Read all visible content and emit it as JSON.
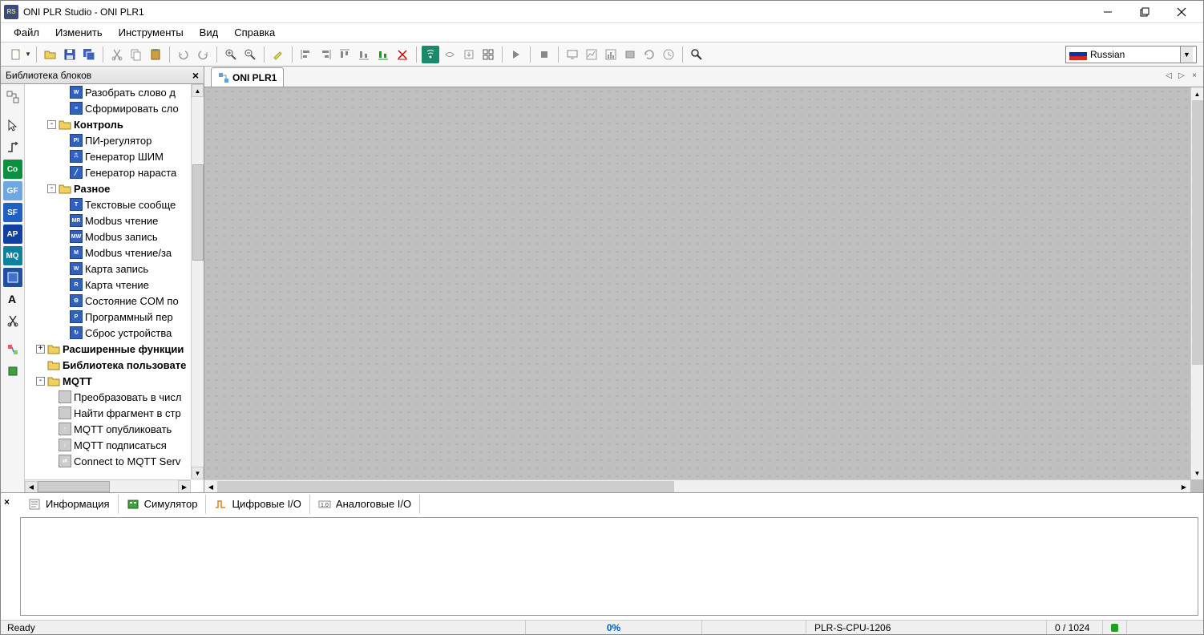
{
  "title": "ONI PLR Studio - ONI PLR1",
  "app_icon_text": "RS",
  "menu": {
    "file": "Файл",
    "edit": "Изменить",
    "tools": "Инструменты",
    "view": "Вид",
    "help": "Справка"
  },
  "language": {
    "selected": "Russian"
  },
  "lib": {
    "title": "Библиотека блоков",
    "items": [
      {
        "indent": 4,
        "icon": "blue-w",
        "label": "Разобрать слово д"
      },
      {
        "indent": 4,
        "icon": "blue-s",
        "label": "Сформировать сло"
      },
      {
        "indent": 2,
        "folder": true,
        "expand": "-",
        "label": "Контроль",
        "bold": true
      },
      {
        "indent": 4,
        "icon": "blue-pi",
        "label": "ПИ-регулятор"
      },
      {
        "indent": 4,
        "icon": "blue-pwm",
        "label": "Генератор ШИМ"
      },
      {
        "indent": 4,
        "icon": "blue-ramp",
        "label": "Генератор нараста"
      },
      {
        "indent": 2,
        "folder": true,
        "expand": "-",
        "label": "Разное",
        "bold": true
      },
      {
        "indent": 4,
        "icon": "blue-t",
        "label": "Текстовые сообще"
      },
      {
        "indent": 4,
        "icon": "blue-mr",
        "label": "Modbus чтение"
      },
      {
        "indent": 4,
        "icon": "blue-mw",
        "label": "Modbus запись"
      },
      {
        "indent": 4,
        "icon": "blue-mrw",
        "label": "Modbus чтение/за"
      },
      {
        "indent": 4,
        "icon": "blue-cw",
        "label": "Карта запись"
      },
      {
        "indent": 4,
        "icon": "blue-cr",
        "label": "Карта чтение"
      },
      {
        "indent": 4,
        "icon": "blue-com",
        "label": "Состояние COM по"
      },
      {
        "indent": 4,
        "icon": "blue-prog",
        "label": "Программный пер"
      },
      {
        "indent": 4,
        "icon": "blue-rst",
        "label": "Сброс устройства"
      },
      {
        "indent": 1,
        "folder": true,
        "expand": "+",
        "label": "Расширенные функции",
        "bold": true
      },
      {
        "indent": 1,
        "folder": true,
        "expand": "",
        "label": "Библиотека пользовате",
        "bold": true
      },
      {
        "indent": 1,
        "folder": true,
        "expand": "-",
        "label": "MQTT",
        "bold": true
      },
      {
        "indent": 3,
        "icon": "grey",
        "label": "Преобразовать в числ"
      },
      {
        "indent": 3,
        "icon": "grey",
        "label": "Найти фрагмент в стр"
      },
      {
        "indent": 3,
        "icon": "grey-up",
        "label": "MQTT опубликовать"
      },
      {
        "indent": 3,
        "icon": "grey-down",
        "label": "MQTT подписаться"
      },
      {
        "indent": 3,
        "icon": "grey-conn",
        "label": "Connect to MQTT Serv"
      }
    ]
  },
  "vtools": {
    "co": "Co",
    "gf": "GF",
    "sf": "SF",
    "ap": "AP",
    "mq": "MQ"
  },
  "tabs": {
    "main": "ONI PLR1"
  },
  "bottom": {
    "info": "Информация",
    "sim": "Симулятор",
    "dio": "Цифровые I/O",
    "aio": "Аналоговые I/O"
  },
  "status": {
    "ready": "Ready",
    "percent": "0%",
    "cpu": "PLR-S-CPU-1206",
    "mem": "0 / 1024"
  }
}
